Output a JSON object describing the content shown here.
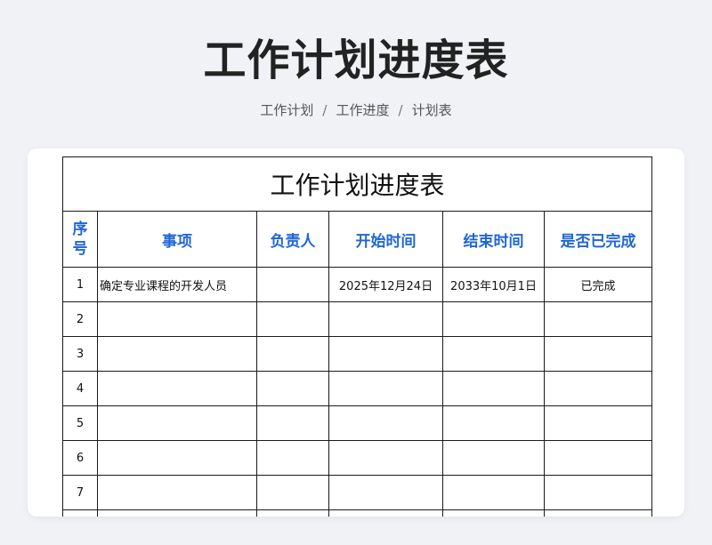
{
  "page": {
    "title": "工作计划进度表",
    "breadcrumb": [
      "工作计划",
      "工作进度",
      "计划表"
    ]
  },
  "sheet": {
    "title": "工作计划进度表",
    "headers": {
      "num_line1": "序",
      "num_line2": "号",
      "task": "事项",
      "owner": "负责人",
      "start": "开始时间",
      "end": "结束时间",
      "done": "是否已完成"
    },
    "rows": [
      {
        "num": "1",
        "task": "确定专业课程的开发人员",
        "owner": "",
        "start": "2025年12月24日",
        "end": "2033年10月1日",
        "done": "已完成"
      },
      {
        "num": "2",
        "task": "",
        "owner": "",
        "start": "",
        "end": "",
        "done": ""
      },
      {
        "num": "3",
        "task": "",
        "owner": "",
        "start": "",
        "end": "",
        "done": ""
      },
      {
        "num": "4",
        "task": "",
        "owner": "",
        "start": "",
        "end": "",
        "done": ""
      },
      {
        "num": "5",
        "task": "",
        "owner": "",
        "start": "",
        "end": "",
        "done": ""
      },
      {
        "num": "6",
        "task": "",
        "owner": "",
        "start": "",
        "end": "",
        "done": ""
      },
      {
        "num": "7",
        "task": "",
        "owner": "",
        "start": "",
        "end": "",
        "done": ""
      },
      {
        "num": "",
        "task": "",
        "owner": "",
        "start": "",
        "end": "",
        "done": ""
      }
    ]
  },
  "colors": {
    "header_text": "#1f66d6",
    "background": "#f1f2f5"
  }
}
